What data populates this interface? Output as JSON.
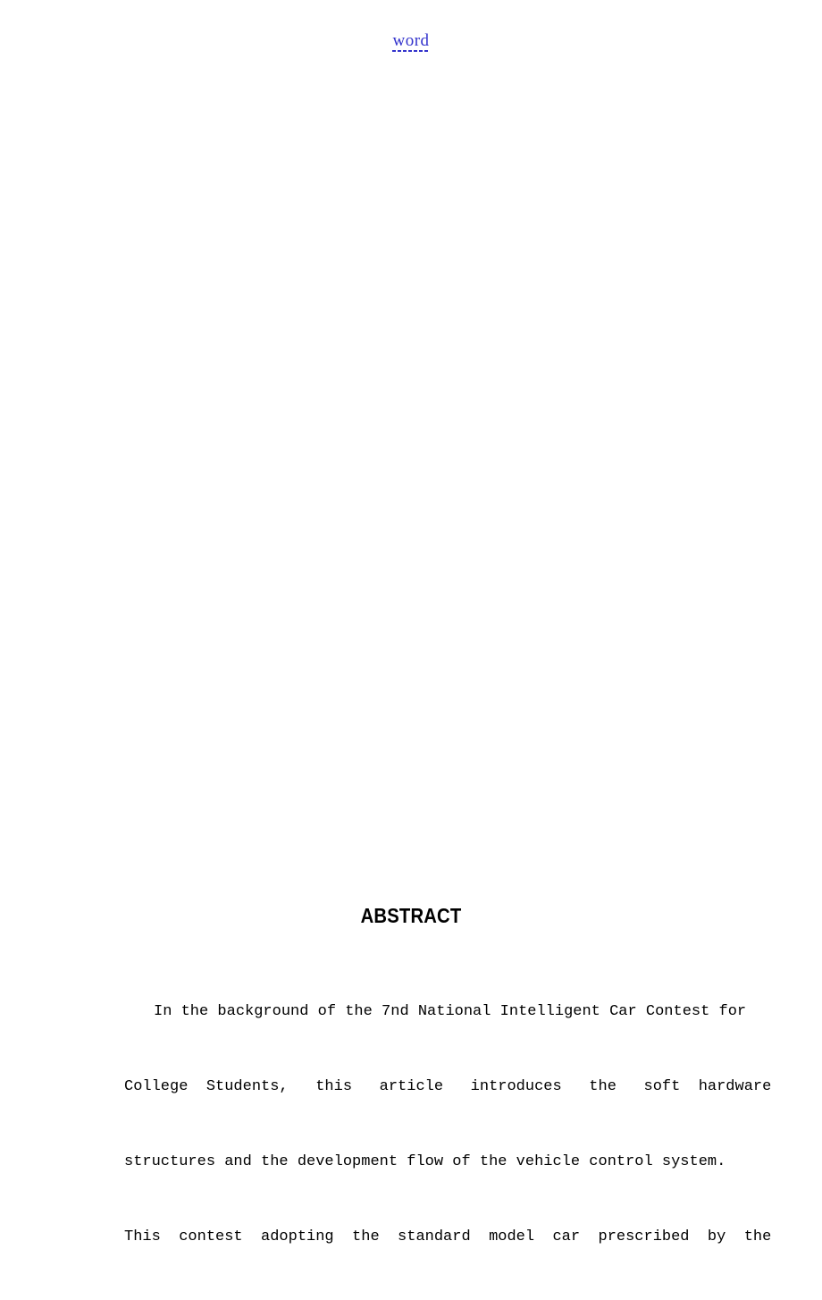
{
  "document": {
    "page_background": "#ffffff",
    "text_color": "#000000"
  },
  "header": {
    "link_label": "word",
    "link_color": "#3333cc",
    "underline_style": "dotted"
  },
  "abstract": {
    "title": "ABSTRACT",
    "lines": [
      "In the background of the 7nd National Intelligent Car Contest for",
      "College  Students,   this   article   introduces   the   soft  hardware",
      "structures and the development flow of the vehicle control system.",
      "This  contest  adopting  the  standard  model  car  prescribed  by  the"
    ],
    "line_1": "In the background of the 7nd National Intelligent Car Contest for",
    "line_2": "College  Students,   this   article   introduces   the   soft  hardware",
    "line_3": "structures and the development flow of the vehicle control system.",
    "line_4": "This  contest  adopting  the  standard  model  car  prescribed  by  the"
  }
}
